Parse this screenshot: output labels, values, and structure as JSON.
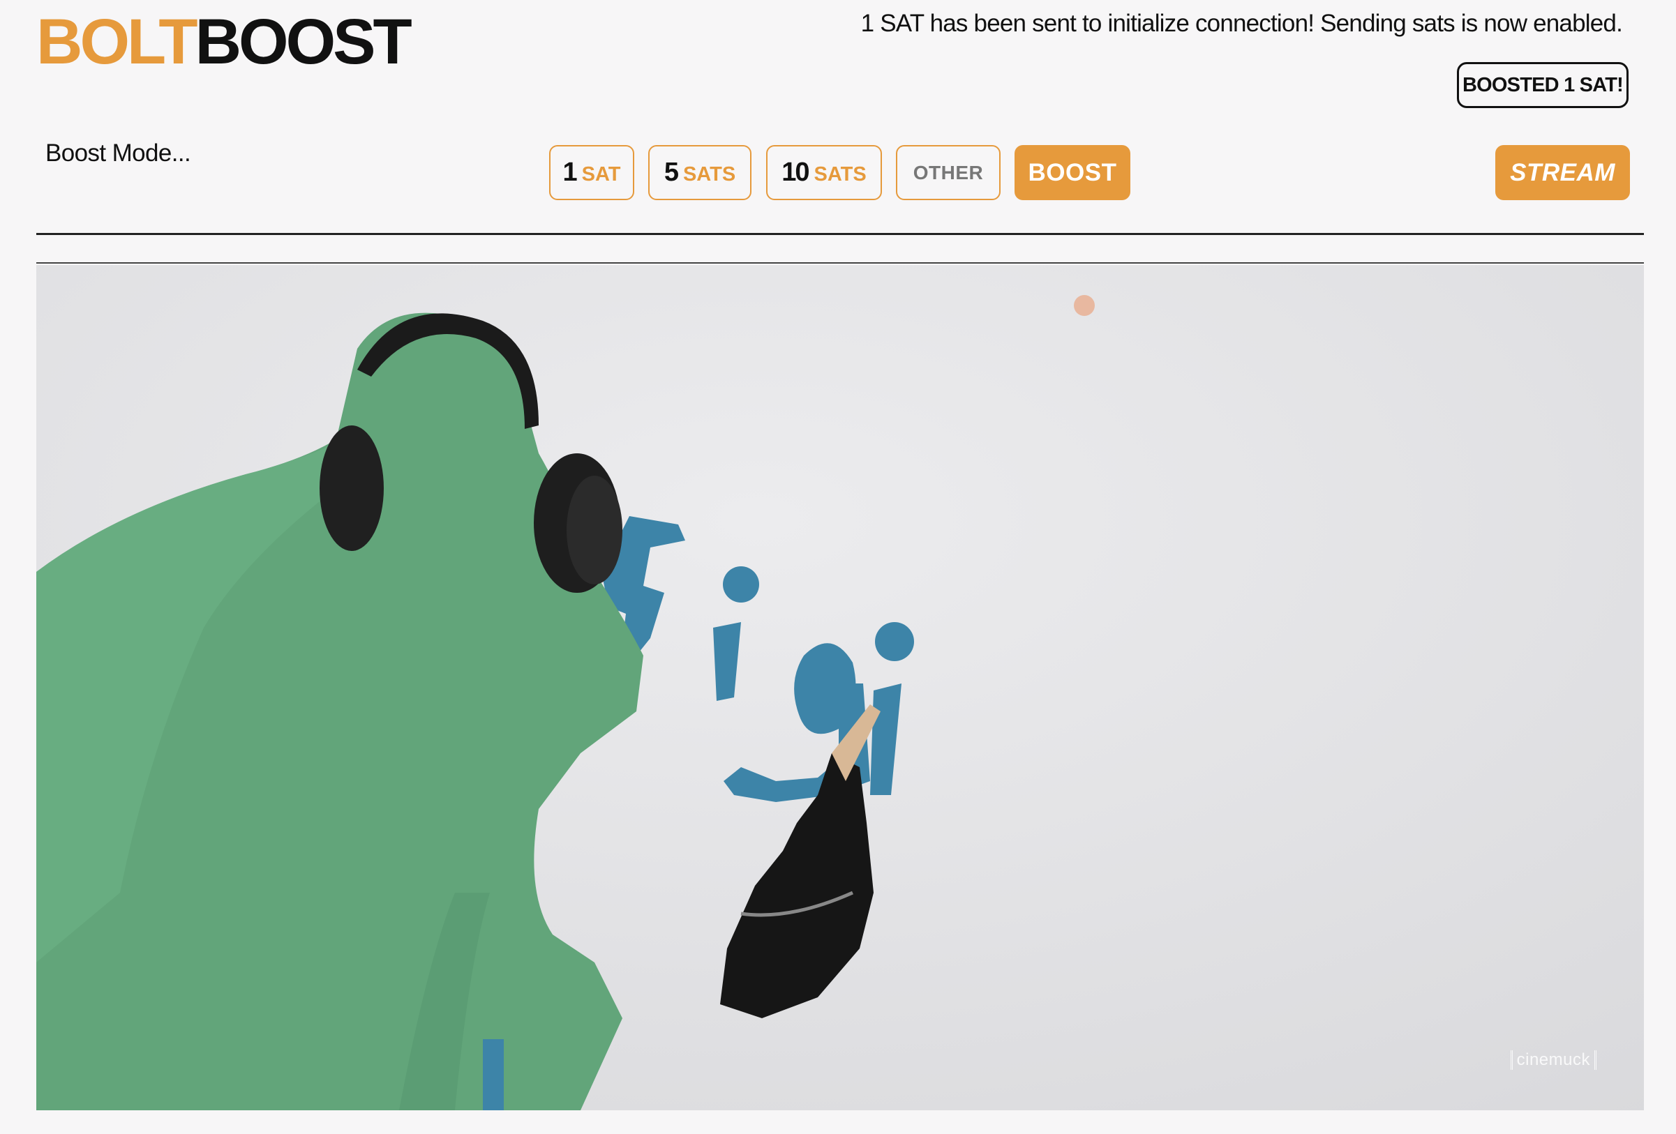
{
  "logo": {
    "part1": "BOLT",
    "part2": "BOOST"
  },
  "status": {
    "message": "1 SAT has been sent to initialize connection! Sending sats is now enabled.",
    "badge": "BOOSTED 1 SAT!"
  },
  "boost_mode": {
    "label": "Boost Mode..."
  },
  "amounts": [
    {
      "num": "1",
      "unit": "SAT"
    },
    {
      "num": "5",
      "unit": "SATS"
    },
    {
      "num": "10",
      "unit": "SATS"
    }
  ],
  "buttons": {
    "other": "OTHER",
    "boost": "BOOST",
    "stream": "STREAM"
  },
  "video": {
    "watermark": "cinemuck"
  },
  "colors": {
    "accent": "#e69a3c",
    "background": "#f7f6f7",
    "text": "#111111"
  }
}
